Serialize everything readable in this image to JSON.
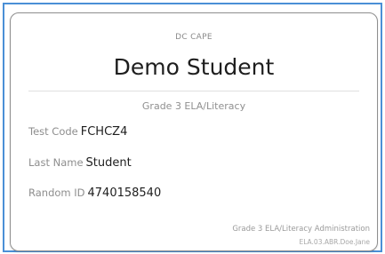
{
  "ticket": {
    "state_label": "DC CAPE",
    "student_name": "Demo Student",
    "test_name": "Grade 3 ELA/Literacy",
    "test_code_label": "Test Code",
    "test_code_value": "FCHCZ4",
    "last_name_label": "Last Name",
    "last_name_value": "Student",
    "random_id_label": "Random ID",
    "random_id_value": "4740158540",
    "administration": "Grade 3 ELA/Literacy Administration",
    "form_code": "ELA.03.ABR.Doe.Jane"
  },
  "colors": {
    "frame_border": "#4a8fd6",
    "card_border": "#8e8e8e",
    "label_text": "#8e8e8e",
    "value_text": "#1e1e1e"
  }
}
